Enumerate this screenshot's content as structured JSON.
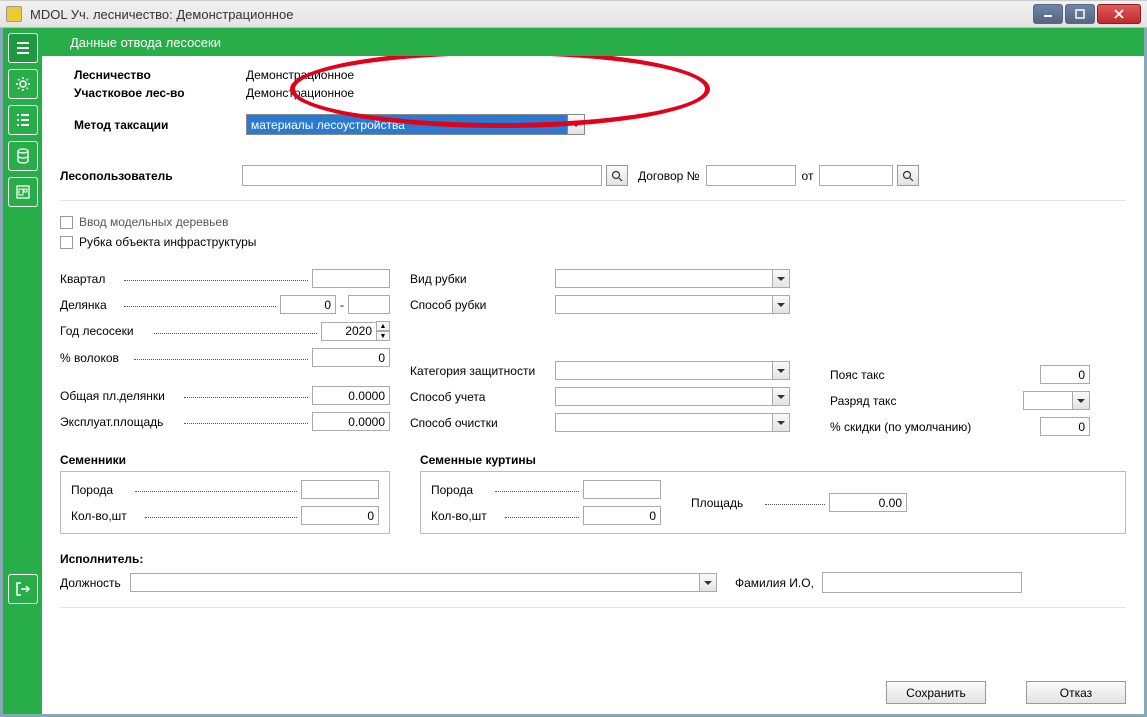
{
  "titlebar": {
    "title": "МDOL    Уч. лесничество: Демонстрационное"
  },
  "header": {
    "title": "Данные отвода лесосеки"
  },
  "info": {
    "forestry_label": "Лесничество",
    "forestry_value": "Демонстрационное",
    "subforestry_label": "Участковое лес-во",
    "subforestry_value": "Демонстрационное",
    "method_label": "Метод таксации",
    "method_value": "материалы лесоустройства"
  },
  "user": {
    "label": "Лесопользователь",
    "contract_label": "Договор №",
    "from_label": "от"
  },
  "checks": {
    "model_trees": "Ввод модельных деревьев",
    "infra": "Рубка объекта инфраструктуры"
  },
  "left": {
    "kvartal": "Квартал",
    "delyanka": "Делянка",
    "delyanka_val": "0",
    "year": "Год лесосеки",
    "year_val": "2020",
    "volok": "% волоков",
    "volok_val": "0",
    "total_area": "Общая пл.делянки",
    "total_area_val": "0.0000",
    "expl_area": "Эксплуат.площадь",
    "expl_area_val": "0.0000"
  },
  "mid": {
    "cut_type": "Вид рубки",
    "cut_method": "Способ рубки",
    "protection": "Категория защитности",
    "account": "Способ учета",
    "clean": "Способ очистки"
  },
  "right": {
    "tax_belt": "Пояс такс",
    "tax_belt_val": "0",
    "tax_rank": "Разряд такс",
    "discount": "% скидки (по умолчанию)",
    "discount_val": "0"
  },
  "seed": {
    "semenniki": "Семенники",
    "kurtiny": "Семенные куртины",
    "poroda": "Порода",
    "kolvo": "Кол-во,шт",
    "kolvo_val": "0",
    "ploshad": "Площадь",
    "ploshad_val": "0.00"
  },
  "exec": {
    "title": "Исполнитель:",
    "pos": "Должность",
    "fio": "Фамилия И.О,"
  },
  "buttons": {
    "save": "Сохранить",
    "cancel": "Отказ"
  }
}
